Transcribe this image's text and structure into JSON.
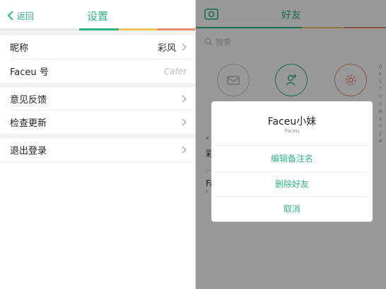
{
  "settings": {
    "back_label": "返回",
    "title": "设置",
    "rows": [
      {
        "label": "昵称",
        "value": "彩风"
      },
      {
        "label": "Faceu 号",
        "value": "Cafer"
      },
      {
        "label": "意见反馈"
      },
      {
        "label": "检查更新"
      },
      {
        "label": "退出登录"
      }
    ]
  },
  "friends": {
    "title": "好友",
    "search_placeholder": "搜索",
    "background_text": [
      "彩",
      "Fa",
      "F",
      "#",
      "厂"
    ],
    "alphabet": [
      "Q",
      "R",
      "S",
      "T",
      "U",
      "V",
      "W",
      "X",
      "Y",
      "Z",
      "#"
    ]
  },
  "dialog": {
    "name": "Faceu小妹",
    "sub": "Faceu",
    "actions": [
      "编辑备注名",
      "删除好友",
      "取消"
    ]
  },
  "colors": {
    "accent_green": "#2fb48a",
    "accent_yellow": "#f1c860",
    "accent_red": "#ef8a74"
  }
}
